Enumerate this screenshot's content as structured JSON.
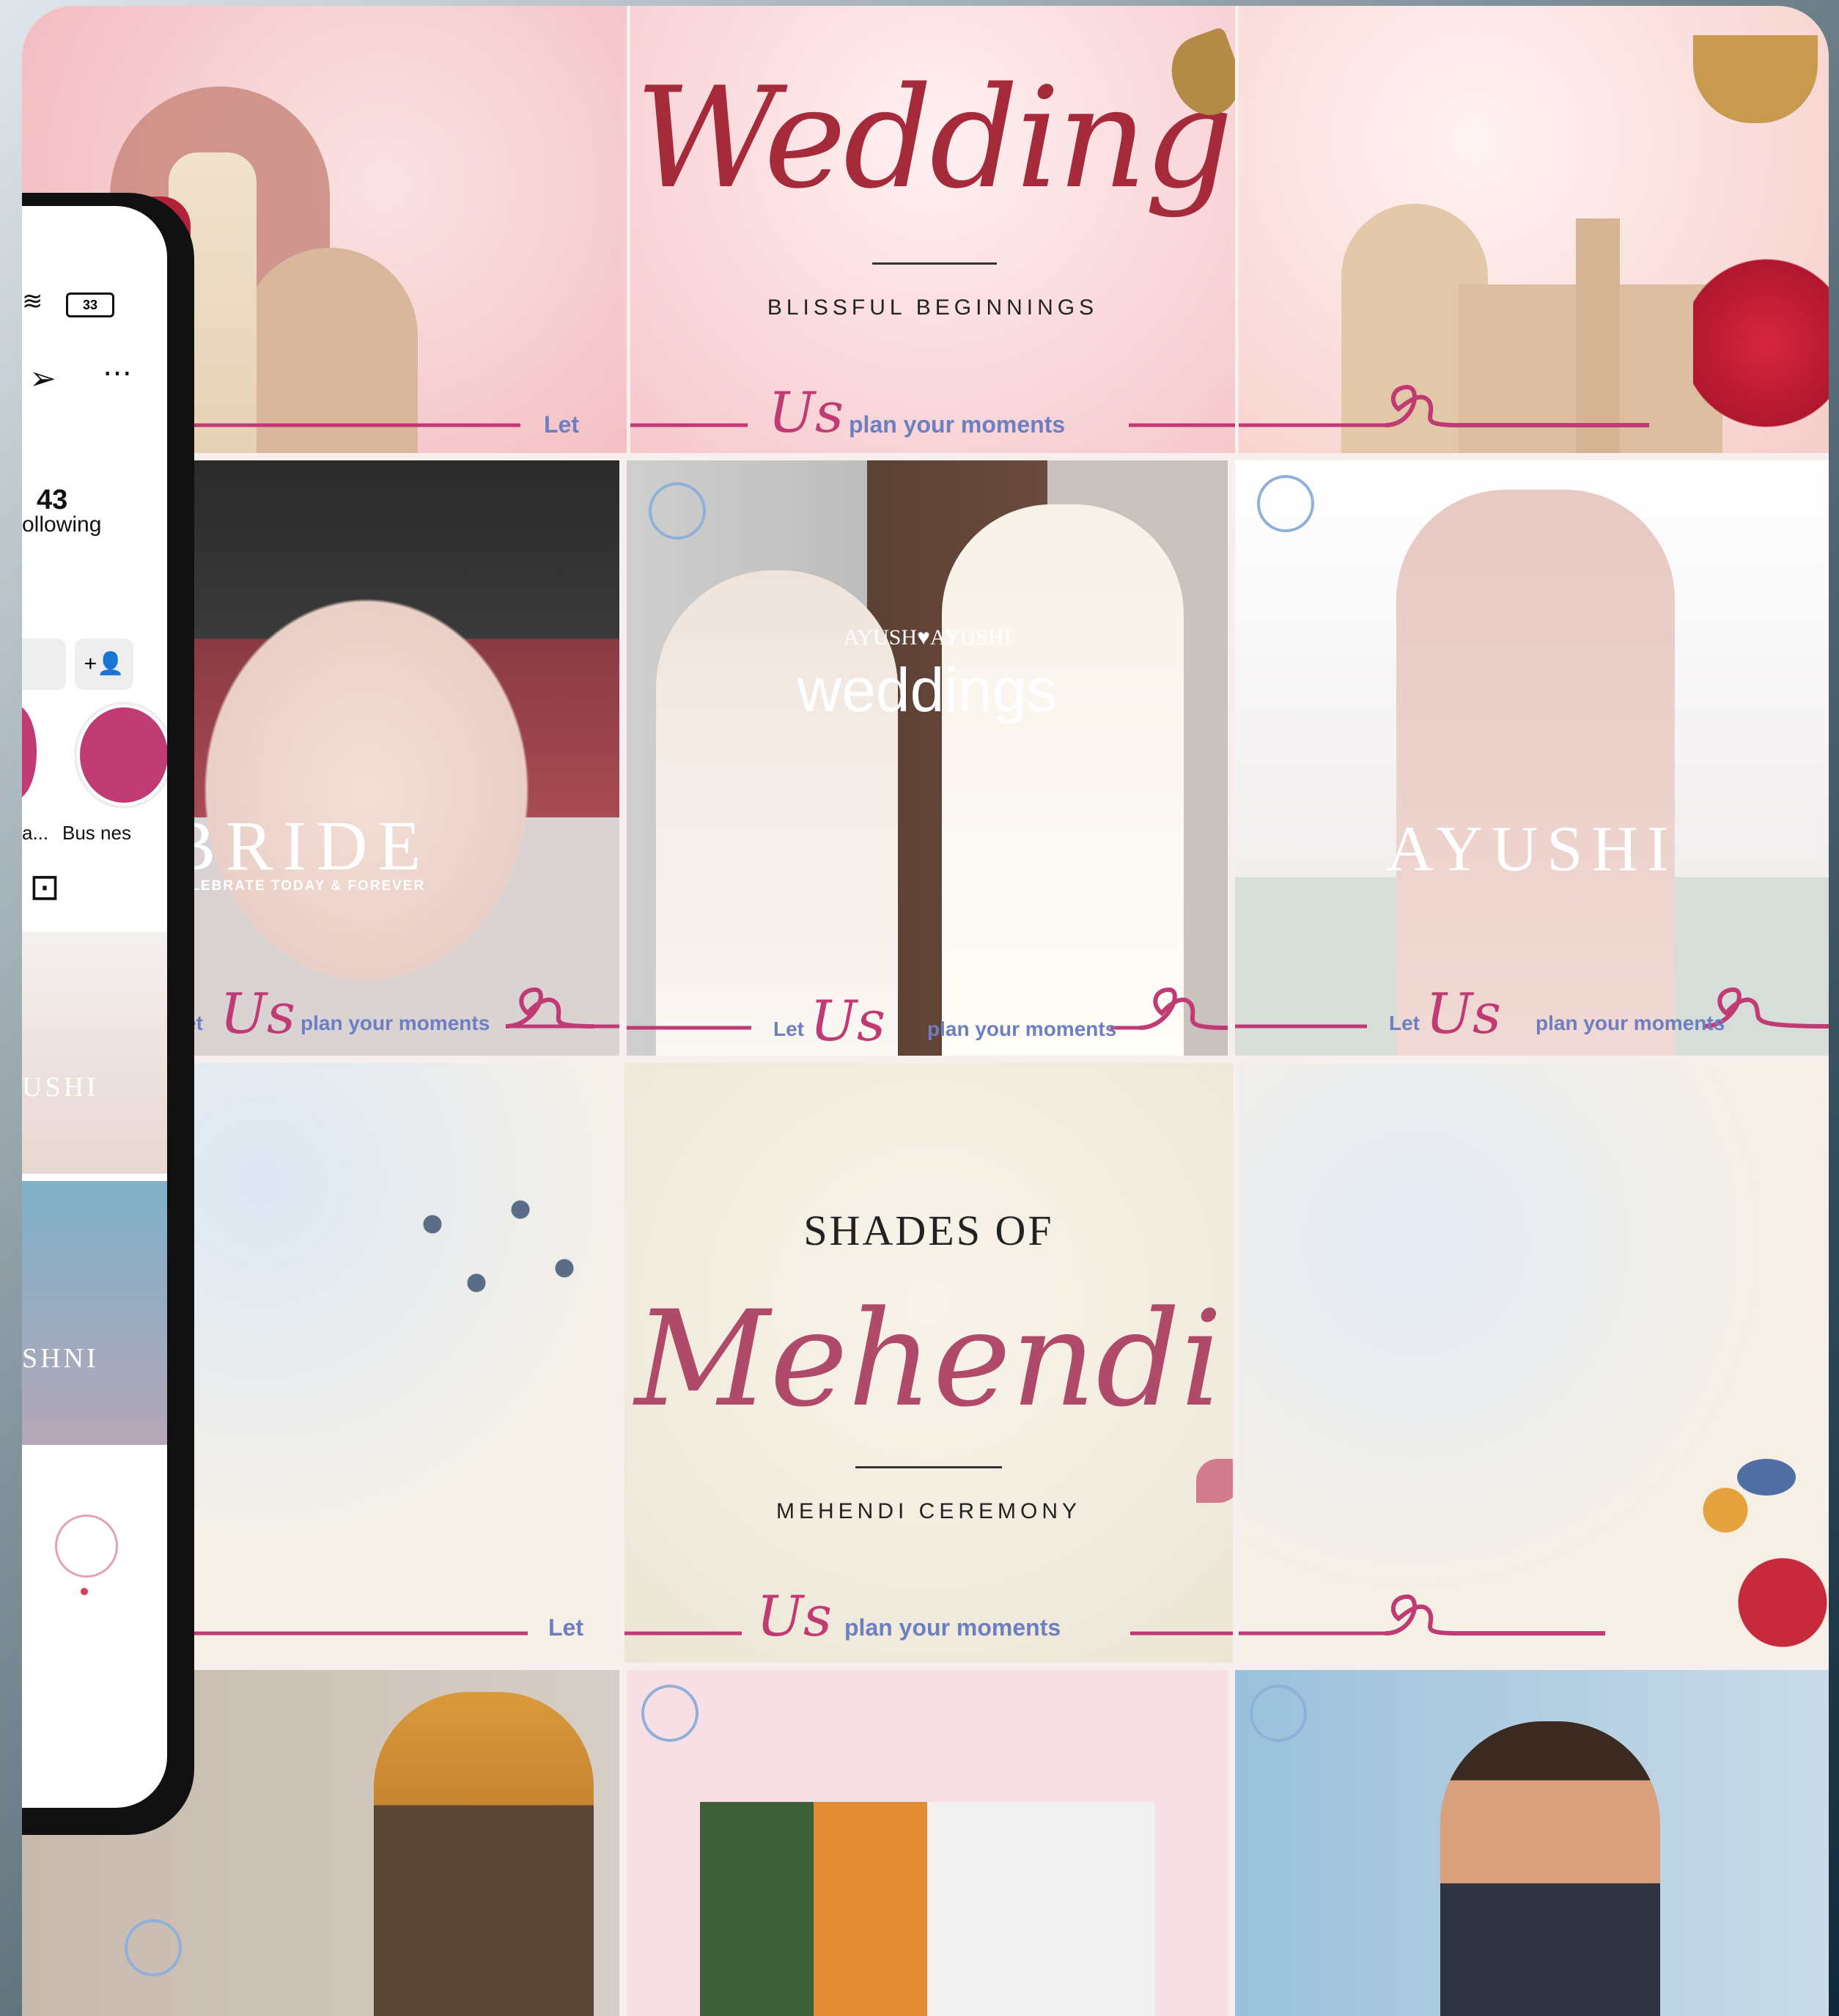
{
  "tiles": {
    "t1": {
      "let": "Let"
    },
    "t2": {
      "title": "Wedding",
      "subtitle": "BLISSFUL BEGINNINGS",
      "us": "Us",
      "tagline": "plan your moments"
    },
    "t4": {
      "title": "BRIDE",
      "subtitle": "CELEBRATE TODAY & FOREVER",
      "let": "Let",
      "us": "Us",
      "tagline": "plan your moments"
    },
    "t5": {
      "names": "AYUSH♥AYUSHI",
      "title": "weddings",
      "let": "Let",
      "us": "Us",
      "tagline": "plan your moments"
    },
    "t6": {
      "title": "AYUSHI",
      "let": "Let",
      "us": "Us",
      "tagline": "plan your moments"
    },
    "t7": {
      "let": "Let"
    },
    "t8": {
      "pre": "SHADES OF",
      "title": "Mehendi",
      "subtitle": "MEHENDI CEREMONY",
      "us": "Us",
      "tagline": "plan your moments"
    }
  },
  "phone": {
    "following_count": "43",
    "following_label": "ollowing",
    "highlight_label": "a...",
    "business_label": "Bus nes",
    "thumb1": "USHI",
    "thumb2": "SHNI",
    "battery": "33"
  },
  "colors": {
    "accent": "#c03a74",
    "tagline": "#6d7fc0",
    "wine": "#a52a3a"
  }
}
